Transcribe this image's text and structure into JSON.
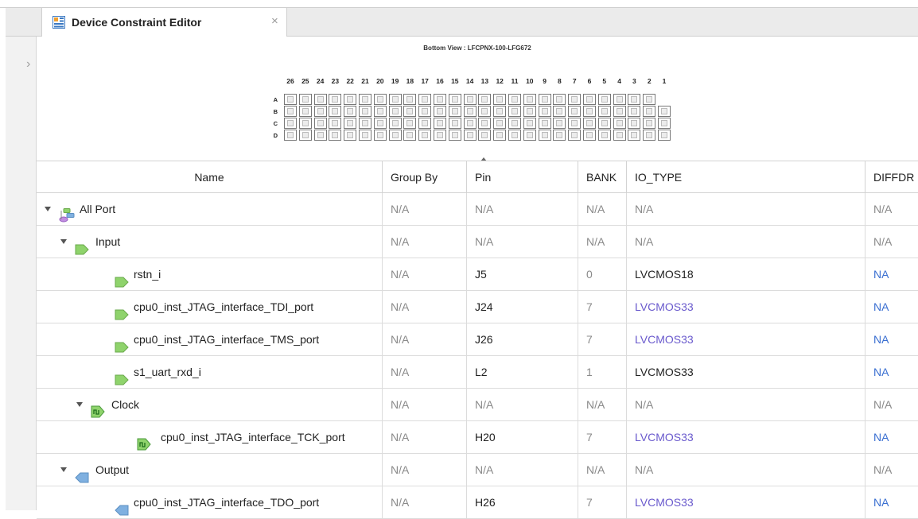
{
  "tab": {
    "title": "Device Constraint Editor",
    "close": "×"
  },
  "side": {
    "chevron": "›"
  },
  "package": {
    "title": "Bottom View : LFCPNX-100-LFG672",
    "columns": [
      "26",
      "25",
      "24",
      "23",
      "22",
      "21",
      "20",
      "19",
      "18",
      "17",
      "16",
      "15",
      "14",
      "13",
      "12",
      "11",
      "10",
      "9",
      "8",
      "7",
      "6",
      "5",
      "4",
      "3",
      "2",
      "1"
    ],
    "rows": [
      "A",
      "B",
      "C",
      "D"
    ]
  },
  "table": {
    "headers": [
      "Name",
      "Group By",
      "Pin",
      "BANK",
      "IO_TYPE",
      "DIFFDR"
    ],
    "rows": [
      {
        "name": "All Port",
        "level": 0,
        "expandable": true,
        "icon": "all-port",
        "group": "N/A",
        "pin": "N/A",
        "bank": "N/A",
        "io": "N/A",
        "diff": "N/A",
        "style": "na"
      },
      {
        "name": "Input",
        "level": 1,
        "expandable": true,
        "icon": "input",
        "group": "N/A",
        "pin": "N/A",
        "bank": "N/A",
        "io": "N/A",
        "diff": "N/A",
        "style": "na"
      },
      {
        "name": "rstn_i",
        "level": 2,
        "expandable": false,
        "icon": "input",
        "group": "N/A",
        "pin": "J5",
        "bank": "0",
        "io": "LVCMOS18",
        "diff": "NA",
        "style": "set",
        "ioStyle": "plain"
      },
      {
        "name": "cpu0_inst_JTAG_interface_TDI_port",
        "level": 2,
        "expandable": false,
        "icon": "input",
        "group": "N/A",
        "pin": "J24",
        "bank": "7",
        "io": "LVCMOS33",
        "diff": "NA",
        "style": "set",
        "ioStyle": "link"
      },
      {
        "name": "cpu0_inst_JTAG_interface_TMS_port",
        "level": 2,
        "expandable": false,
        "icon": "input",
        "group": "N/A",
        "pin": "J26",
        "bank": "7",
        "io": "LVCMOS33",
        "diff": "NA",
        "style": "set",
        "ioStyle": "link"
      },
      {
        "name": "s1_uart_rxd_i",
        "level": 2,
        "expandable": false,
        "icon": "input",
        "group": "N/A",
        "pin": "L2",
        "bank": "1",
        "io": "LVCMOS33",
        "diff": "NA",
        "style": "set",
        "ioStyle": "plain"
      },
      {
        "name": "Clock",
        "level": 2,
        "expandable": true,
        "icon": "clock",
        "group": "N/A",
        "pin": "N/A",
        "bank": "N/A",
        "io": "N/A",
        "diff": "N/A",
        "style": "na"
      },
      {
        "name": "cpu0_inst_JTAG_interface_TCK_port",
        "level": 3,
        "expandable": false,
        "icon": "clock",
        "group": "N/A",
        "pin": "H20",
        "bank": "7",
        "io": "LVCMOS33",
        "diff": "NA",
        "style": "set",
        "ioStyle": "link"
      },
      {
        "name": "Output",
        "level": 1,
        "expandable": true,
        "icon": "output",
        "group": "N/A",
        "pin": "N/A",
        "bank": "N/A",
        "io": "N/A",
        "diff": "N/A",
        "style": "na"
      },
      {
        "name": "cpu0_inst_JTAG_interface_TDO_port",
        "level": 2,
        "expandable": false,
        "icon": "output",
        "group": "N/A",
        "pin": "H26",
        "bank": "7",
        "io": "LVCMOS33",
        "diff": "NA",
        "style": "set",
        "ioStyle": "link"
      }
    ]
  },
  "colors": {
    "input_icon": "#8fd36c",
    "output_icon": "#7fb0e0",
    "clock_icon": "#4caf50",
    "link": "#6a5acd",
    "na_blue": "#3a6fd1"
  }
}
